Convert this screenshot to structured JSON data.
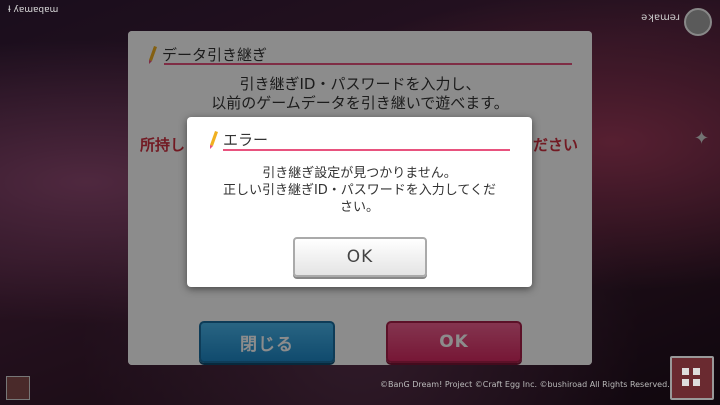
{
  "status_bar": {
    "player_id": "Ɨ ʎɐɯɐqɐɯ",
    "right_text": "ǝʞɐɯǝɹ"
  },
  "back_dialog": {
    "title": "データ引き継ぎ",
    "description_line1": "引き継ぎID・パスワードを入力し、",
    "description_line2": "以前のゲームデータを引き継いで遊べます。",
    "warning_left": "所持し",
    "warning_right": "ださい",
    "close_button": "閉じる",
    "ok_button": "OK"
  },
  "error_dialog": {
    "title": "エラー",
    "message_line1": "引き継ぎ設定が見つかりません。",
    "message_line2": "正しい引き継ぎID・パスワードを入力してくだ",
    "message_line3": "さい。",
    "ok_button": "OK"
  },
  "footer": {
    "text_a": "©BanG Dream! Project ©Craft Egg Inc. ©bushiroad All Rights Reserved.",
    "text_b": "",
    "text_c": ""
  },
  "colors": {
    "accent_pink": "#e8527e",
    "warning_red": "#d03040",
    "close_blue": "#1e88c8"
  },
  "icons": {
    "title_icon": "pencil-icon",
    "settings": "settings-badge-icon",
    "menu": "grid-menu-icon"
  }
}
